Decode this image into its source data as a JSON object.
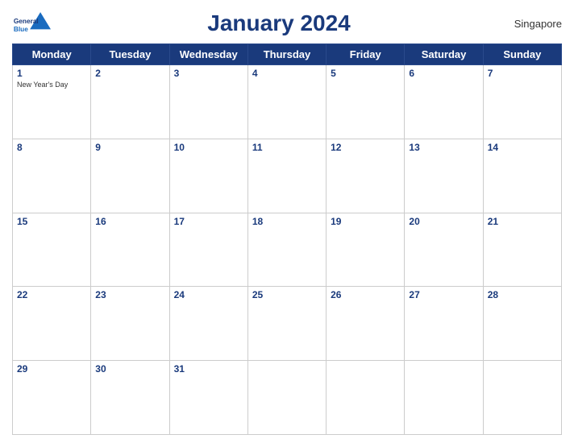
{
  "header": {
    "logo_line1": "General",
    "logo_line2": "Blue",
    "title": "January 2024",
    "region": "Singapore"
  },
  "days_of_week": [
    "Monday",
    "Tuesday",
    "Wednesday",
    "Thursday",
    "Friday",
    "Saturday",
    "Sunday"
  ],
  "weeks": [
    [
      {
        "day": "1",
        "holiday": "New Year's Day"
      },
      {
        "day": "2",
        "holiday": ""
      },
      {
        "day": "3",
        "holiday": ""
      },
      {
        "day": "4",
        "holiday": ""
      },
      {
        "day": "5",
        "holiday": ""
      },
      {
        "day": "6",
        "holiday": ""
      },
      {
        "day": "7",
        "holiday": ""
      }
    ],
    [
      {
        "day": "8",
        "holiday": ""
      },
      {
        "day": "9",
        "holiday": ""
      },
      {
        "day": "10",
        "holiday": ""
      },
      {
        "day": "11",
        "holiday": ""
      },
      {
        "day": "12",
        "holiday": ""
      },
      {
        "day": "13",
        "holiday": ""
      },
      {
        "day": "14",
        "holiday": ""
      }
    ],
    [
      {
        "day": "15",
        "holiday": ""
      },
      {
        "day": "16",
        "holiday": ""
      },
      {
        "day": "17",
        "holiday": ""
      },
      {
        "day": "18",
        "holiday": ""
      },
      {
        "day": "19",
        "holiday": ""
      },
      {
        "day": "20",
        "holiday": ""
      },
      {
        "day": "21",
        "holiday": ""
      }
    ],
    [
      {
        "day": "22",
        "holiday": ""
      },
      {
        "day": "23",
        "holiday": ""
      },
      {
        "day": "24",
        "holiday": ""
      },
      {
        "day": "25",
        "holiday": ""
      },
      {
        "day": "26",
        "holiday": ""
      },
      {
        "day": "27",
        "holiday": ""
      },
      {
        "day": "28",
        "holiday": ""
      }
    ],
    [
      {
        "day": "29",
        "holiday": ""
      },
      {
        "day": "30",
        "holiday": ""
      },
      {
        "day": "31",
        "holiday": ""
      },
      {
        "day": "",
        "holiday": ""
      },
      {
        "day": "",
        "holiday": ""
      },
      {
        "day": "",
        "holiday": ""
      },
      {
        "day": "",
        "holiday": ""
      }
    ]
  ]
}
